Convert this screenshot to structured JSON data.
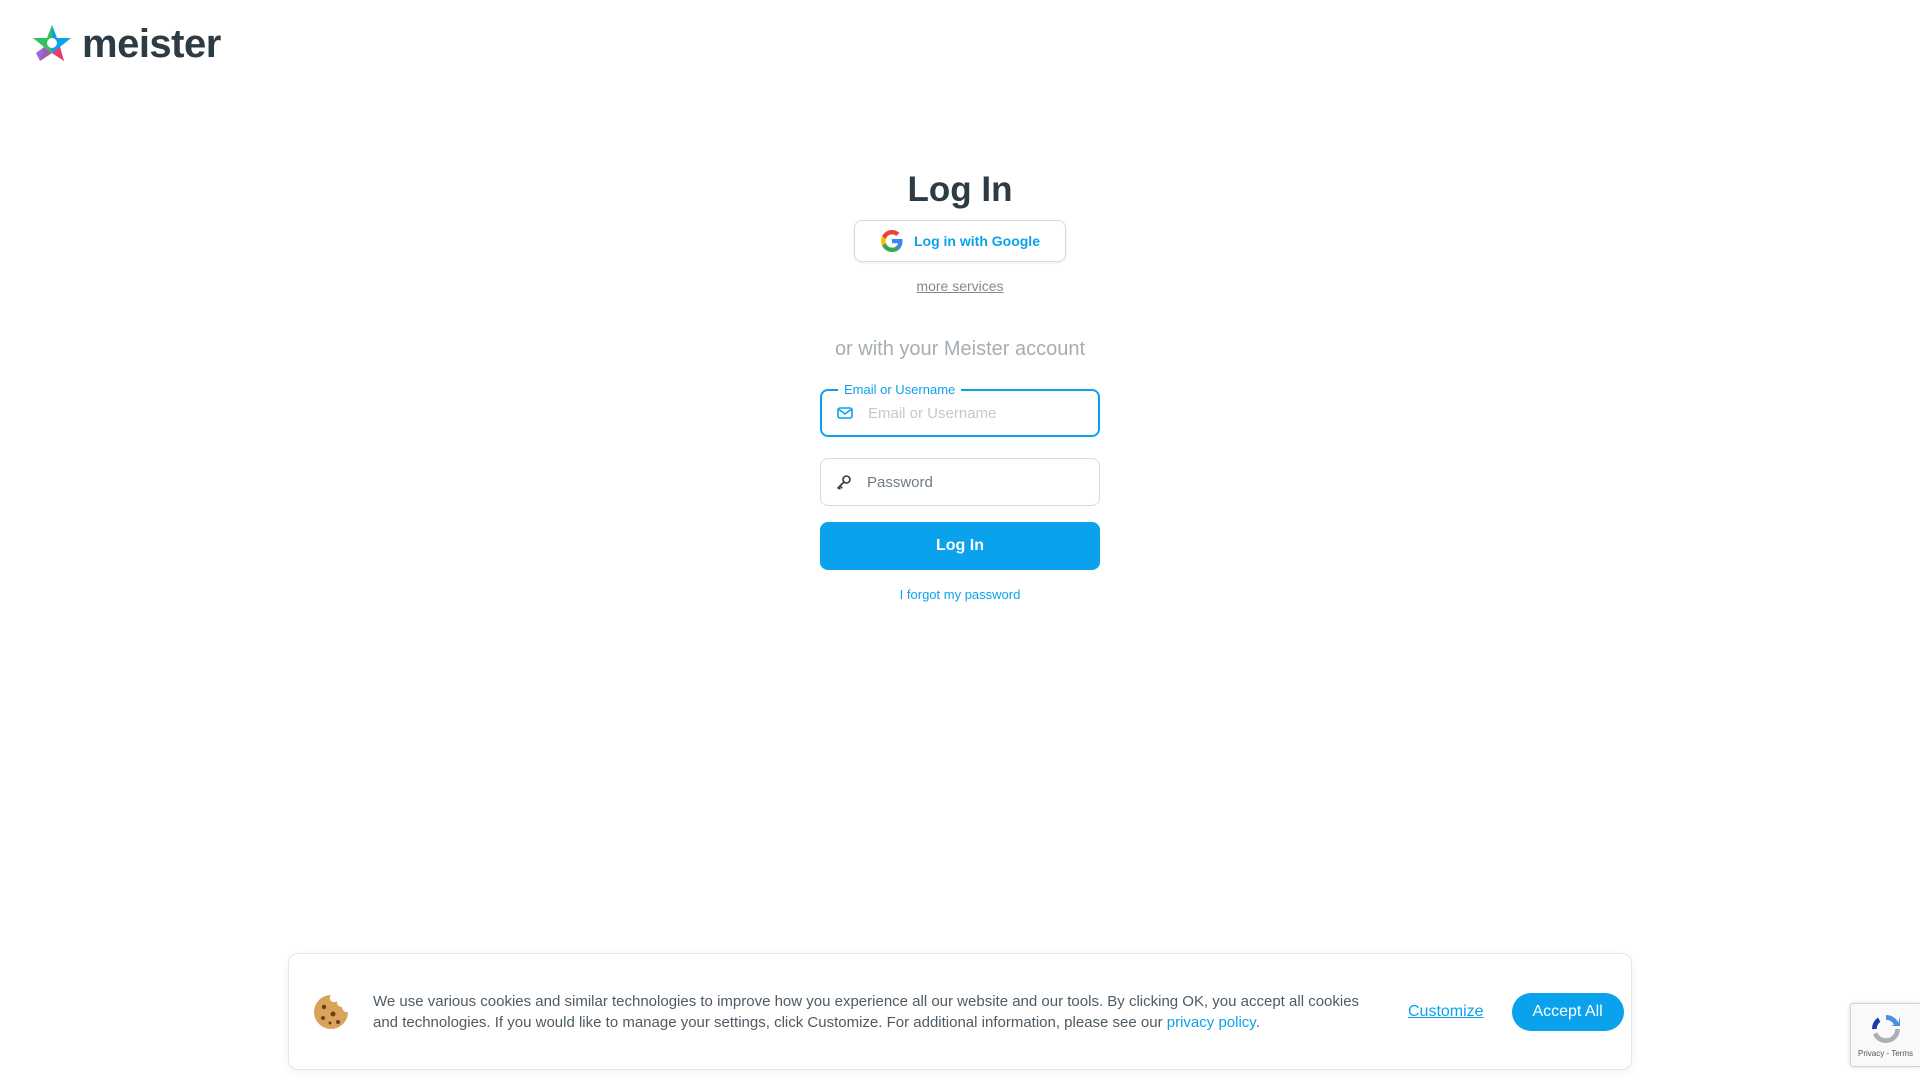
{
  "brand": {
    "name": "meister",
    "accent_color": "#0aa2ec",
    "logo_icon": "meister-star-icon"
  },
  "login": {
    "title": "Log In",
    "google_button_label": "Log in with Google",
    "google_icon": "google-icon",
    "more_services_label": "more services",
    "divider_text": "or with your Meister account",
    "email_field": {
      "label": "Email or Username",
      "placeholder": "Email or Username",
      "value": "",
      "icon": "envelope-icon"
    },
    "password_field": {
      "placeholder": "Password",
      "value": "",
      "icon": "key-icon"
    },
    "submit_label": "Log In",
    "forgot_password_label": "I forgot my password"
  },
  "cookie_banner": {
    "icon": "cookie-icon",
    "text_before_link": "We use various cookies and similar technologies to improve how you experience all our website and our tools. By clicking OK, you accept all cookies and technologies. If you would like to manage your settings, click Customize. For additional information, please see our ",
    "link_label": "privacy policy",
    "text_after_link": ".",
    "customize_label": "Customize",
    "accept_label": "Accept All"
  },
  "recaptcha": {
    "icon": "recaptcha-icon",
    "links_label": "Privacy - Terms"
  }
}
